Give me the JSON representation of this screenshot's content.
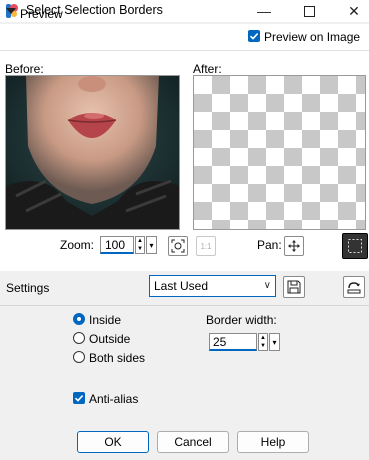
{
  "window": {
    "title": "Select Selection Borders"
  },
  "preview": {
    "header_label": "Preview",
    "preview_on_image_label": "Preview on Image",
    "preview_on_image_checked": true,
    "before_label": "Before:",
    "after_label": "After:",
    "zoom_label": "Zoom:",
    "zoom_value": "100",
    "pan_label": "Pan:"
  },
  "settings": {
    "label": "Settings",
    "preset_value": "Last Used"
  },
  "options": {
    "inside_label": "Inside",
    "outside_label": "Outside",
    "both_sides_label": "Both sides",
    "selected": "Inside",
    "border_width_label": "Border width:",
    "border_width_value": "25",
    "antialias_label": "Anti-alias",
    "antialias_checked": true
  },
  "buttons": {
    "ok": "OK",
    "cancel": "Cancel",
    "help": "Help"
  },
  "colors": {
    "accent": "#0067c0"
  }
}
